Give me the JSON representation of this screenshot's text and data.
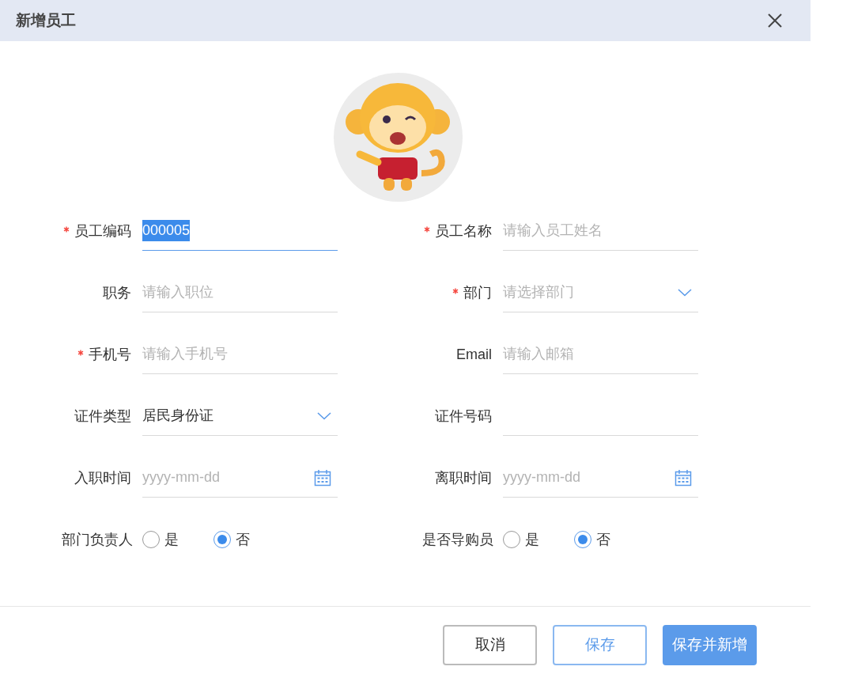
{
  "dialog": {
    "title": "新增员工"
  },
  "fields": [
    {
      "label": "员工编码",
      "required": true,
      "kind": "text",
      "value": "000005",
      "focused": true
    },
    {
      "label": "员工名称",
      "required": true,
      "kind": "text",
      "placeholder": "请输入员工姓名",
      "focused": false
    },
    {
      "label": "职务",
      "required": false,
      "kind": "text",
      "placeholder": "请输入职位",
      "focused": false
    },
    {
      "label": "部门",
      "required": true,
      "kind": "select",
      "placeholder": "请选择部门",
      "focused": false
    },
    {
      "label": "手机号",
      "required": true,
      "kind": "text",
      "placeholder": "请输入手机号",
      "focused": false
    },
    {
      "label": "Email",
      "required": false,
      "kind": "text",
      "placeholder": "请输入邮箱",
      "focused": false
    },
    {
      "label": "证件类型",
      "required": false,
      "kind": "select",
      "value": "居民身份证",
      "focused": false
    },
    {
      "label": "证件号码",
      "required": false,
      "kind": "text",
      "focused": false
    },
    {
      "label": "入职时间",
      "required": false,
      "kind": "date",
      "placeholder": "yyyy-mm-dd",
      "focused": false
    },
    {
      "label": "离职时间",
      "required": false,
      "kind": "date",
      "placeholder": "yyyy-mm-dd",
      "focused": false
    }
  ],
  "radio_groups": [
    {
      "label": "部门负责人",
      "options": [
        {
          "label": "是",
          "selected": false
        },
        {
          "label": "否",
          "selected": true
        }
      ]
    },
    {
      "label": "是否导购员",
      "options": [
        {
          "label": "是",
          "selected": false
        },
        {
          "label": "否",
          "selected": true
        }
      ]
    }
  ],
  "buttons": [
    {
      "label": "取消",
      "kind": "default"
    },
    {
      "label": "保存",
      "kind": "outline"
    },
    {
      "label": "保存并新增",
      "kind": "primary"
    }
  ]
}
